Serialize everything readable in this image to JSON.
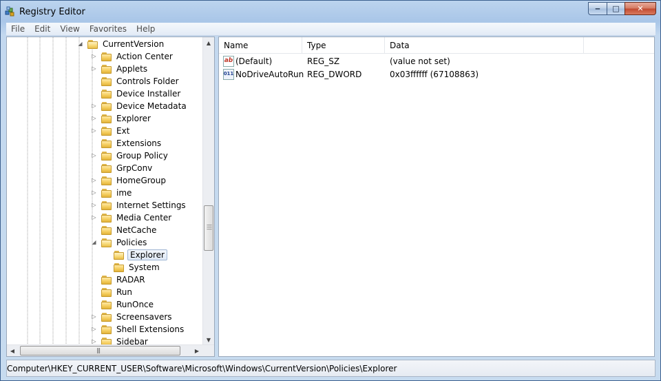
{
  "window": {
    "title": "Registry Editor",
    "minimize": "‒",
    "maximize": "□",
    "close": "✕"
  },
  "menu": [
    "File",
    "Edit",
    "View",
    "Favorites",
    "Help"
  ],
  "tree": {
    "parent": "CurrentVersion",
    "items": [
      {
        "label": "Action Center",
        "expandable": true
      },
      {
        "label": "Applets",
        "expandable": true
      },
      {
        "label": "Controls Folder",
        "expandable": false
      },
      {
        "label": "Device Installer",
        "expandable": false
      },
      {
        "label": "Device Metadata",
        "expandable": true
      },
      {
        "label": "Explorer",
        "expandable": true
      },
      {
        "label": "Ext",
        "expandable": true
      },
      {
        "label": "Extensions",
        "expandable": false
      },
      {
        "label": "Group Policy",
        "expandable": true
      },
      {
        "label": "GrpConv",
        "expandable": false
      },
      {
        "label": "HomeGroup",
        "expandable": true
      },
      {
        "label": "ime",
        "expandable": true
      },
      {
        "label": "Internet Settings",
        "expandable": true
      },
      {
        "label": "Media Center",
        "expandable": true
      },
      {
        "label": "NetCache",
        "expandable": false
      },
      {
        "label": "Policies",
        "expandable": true,
        "expanded": true
      },
      {
        "label": "Explorer",
        "child": true,
        "selected": true
      },
      {
        "label": "System",
        "child": true
      },
      {
        "label": "RADAR",
        "expandable": false
      },
      {
        "label": "Run",
        "expandable": false
      },
      {
        "label": "RunOnce",
        "expandable": false
      },
      {
        "label": "Screensavers",
        "expandable": true
      },
      {
        "label": "Shell Extensions",
        "expandable": true
      },
      {
        "label": "Sidebar",
        "expandable": true
      }
    ]
  },
  "list": {
    "columns": [
      "Name",
      "Type",
      "Data"
    ],
    "rows": [
      {
        "icon": "string-value-icon",
        "glyph": "ab",
        "name": "(Default)",
        "type": "REG_SZ",
        "data": "(value not set)"
      },
      {
        "icon": "dword-value-icon",
        "glyph": "011",
        "name": "NoDriveAutoRun",
        "type": "REG_DWORD",
        "data": "0x03ffffff (67108863)"
      }
    ]
  },
  "status": {
    "path": "Computer\\HKEY_CURRENT_USER\\Software\\Microsoft\\Windows\\CurrentVersion\\Policies\\Explorer"
  }
}
